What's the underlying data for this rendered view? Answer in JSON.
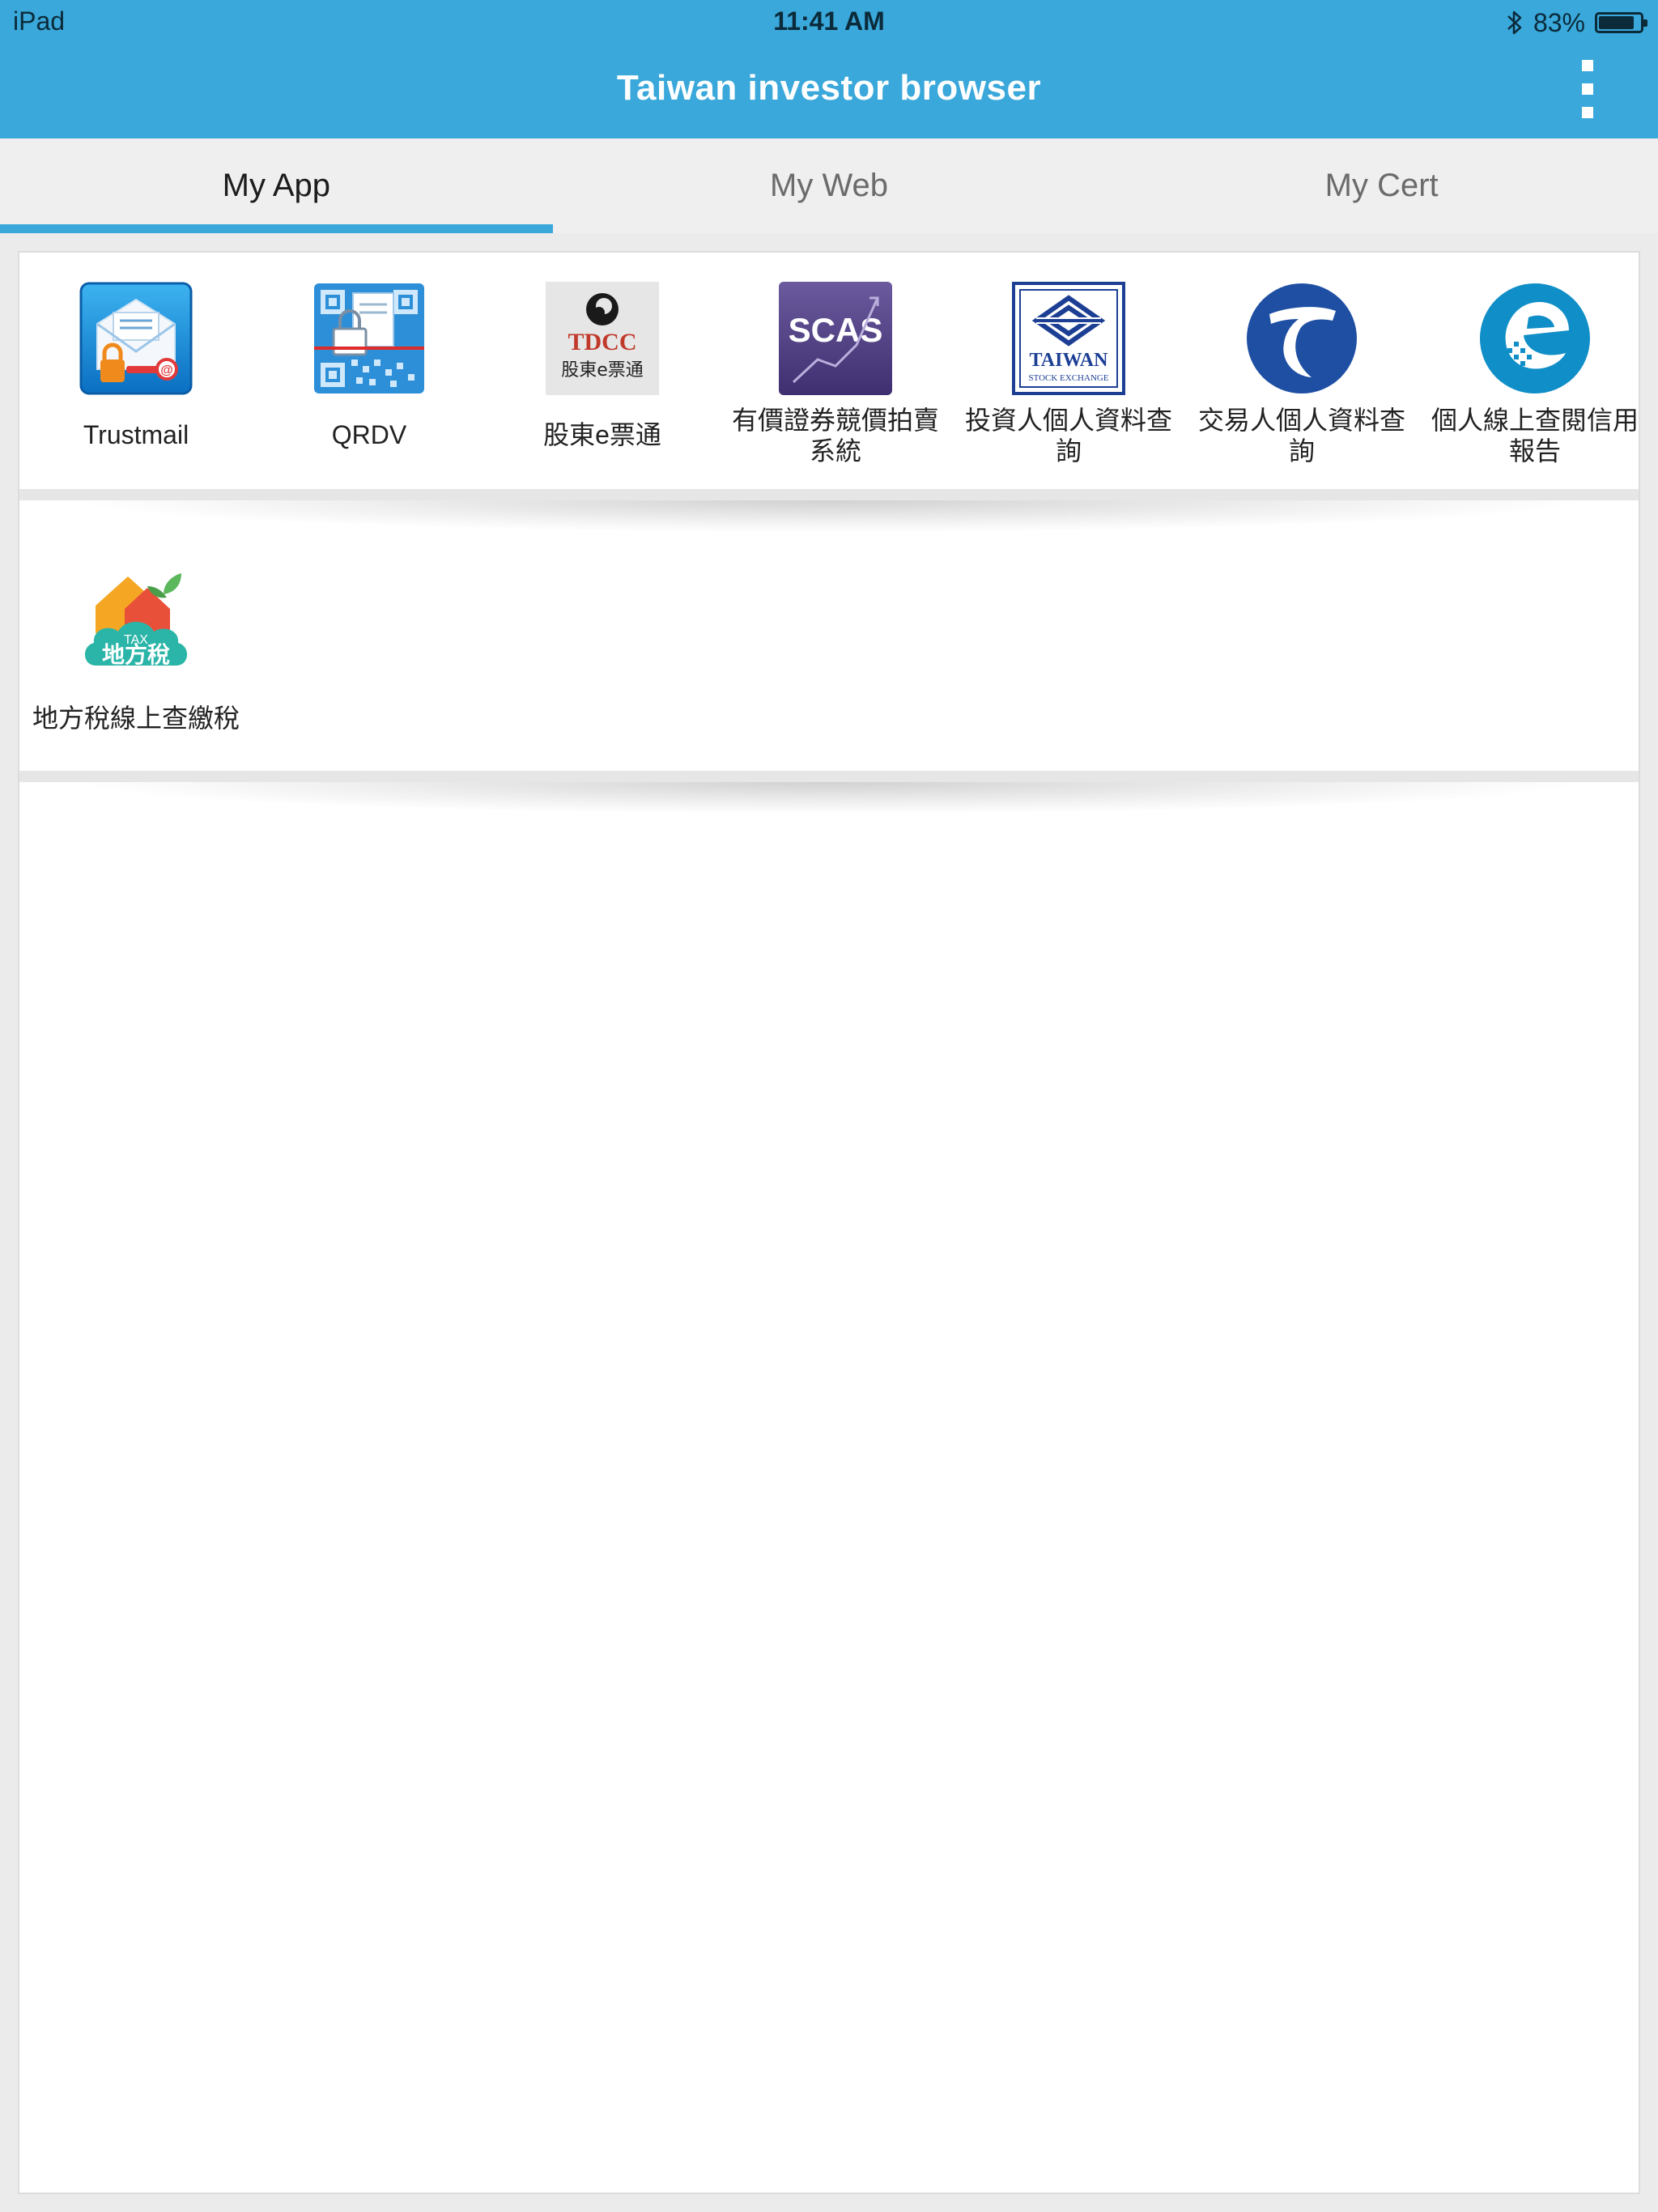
{
  "status_bar": {
    "device": "iPad",
    "time": "11:41 AM",
    "battery_percent": "83%",
    "battery_level": 0.83,
    "bluetooth_icon": "bluetooth-icon"
  },
  "header": {
    "title": "Taiwan investor browser",
    "menu_icon": "vertical-dots-menu-icon"
  },
  "tabs": [
    {
      "label": "My App",
      "active": true
    },
    {
      "label": "My Web",
      "active": false
    },
    {
      "label": "My Cert",
      "active": false
    }
  ],
  "colors": {
    "header_bg": "#3aa8da",
    "active_tab_indicator": "#3aa8da",
    "tab_bar_bg": "#efefef"
  },
  "apps": [
    {
      "label": "Trustmail",
      "icon": "trustmail-envelope-icon"
    },
    {
      "label": "QRDV",
      "icon": "qrdv-qr-lock-icon"
    },
    {
      "label": "股東e票通",
      "icon": "tdcc-logo-icon",
      "icon_text_top": "TDCC",
      "icon_text_bottom": "股東e票通"
    },
    {
      "label": "有價證券競價拍賣系統",
      "label_line1": "有價證券競價拍賣",
      "label_line2": "系統",
      "icon": "scas-chart-icon",
      "icon_text": "SCAS"
    },
    {
      "label": "投資人個人資料查詢",
      "label_line1": "投資人個人資料查",
      "label_line2": "詢",
      "icon": "taiwan-stock-exchange-icon",
      "icon_text_top": "TAIWAN",
      "icon_text_bottom": "STOCK EXCHANGE"
    },
    {
      "label": "交易人個人資料查詢",
      "label_line1": "交易人個人資料查",
      "label_line2": "詢",
      "icon": "taifex-7-logo-icon"
    },
    {
      "label": "個人線上查閱信用報告",
      "label_line1": "個人線上查閱信用",
      "label_line2": "報告",
      "icon": "jcic-e-logo-icon"
    },
    {
      "label": "地方稅線上查繳稅",
      "icon": "local-tax-cloud-icon",
      "icon_text_top": "TAX",
      "icon_text_bottom": "地方稅"
    }
  ]
}
